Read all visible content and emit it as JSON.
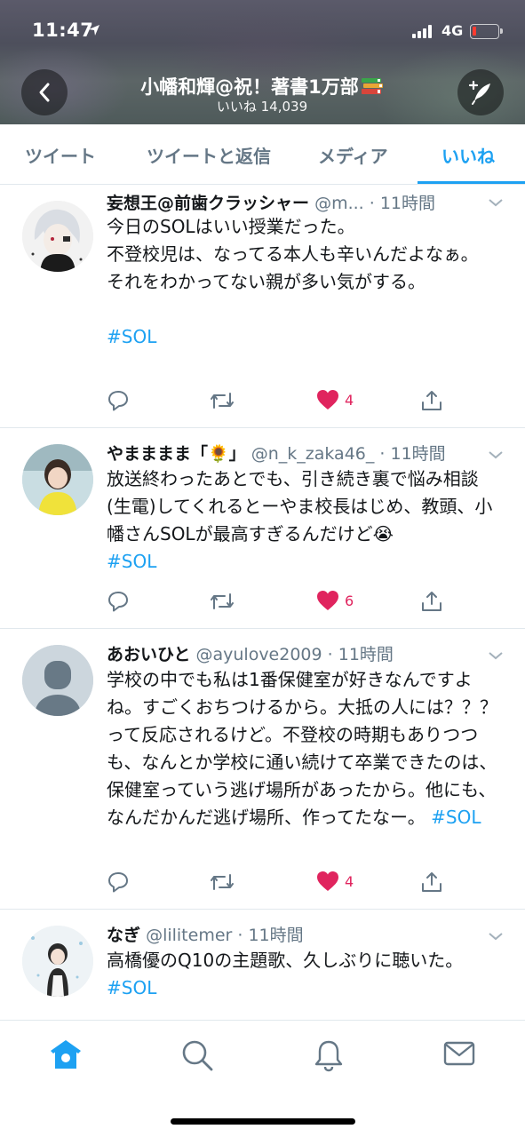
{
  "status_bar": {
    "time": "11:47",
    "network": "4G"
  },
  "header": {
    "title": "小幡和輝@祝！著書1万部",
    "subtitle": "いいね 14,039"
  },
  "tabs": [
    {
      "label": "ツイート",
      "active": false
    },
    {
      "label": "ツイートと返信",
      "active": false
    },
    {
      "label": "メディア",
      "active": false
    },
    {
      "label": "いいね",
      "active": true
    }
  ],
  "tweets": [
    {
      "name": "妄想王@前歯クラッシャー",
      "handle": "@m...",
      "time": "· 11時間",
      "body": "今日のSOLはいい授業だった。\n不登校児は、なってる本人も辛いんだよなぁ。\nそれをわかってない親が多い気がする。\n",
      "hashtag": "#SOL",
      "likes": "4"
    },
    {
      "name": "やまままま「🌻」",
      "handle": "@n_k_zaka46_",
      "time": "· 11時間",
      "body": "放送終わったあとでも、引き続き裏で悩み相談(生電)してくれるとーやま校長はじめ、教頭、小幡さんSOLが最高すぎるんだけど😭",
      "hashtag": "#SOL",
      "likes": "6"
    },
    {
      "name": "あおいひと",
      "handle": "@ayulove2009",
      "time": "· 11時間",
      "body": "学校の中でも私は1番保健室が好きなんですよね。すごくおちつけるから。大抵の人には？？？って反応されるけど。不登校の時期もありつつも、なんとか学校に通い続けて卒業できたのは、保健室っていう逃げ場所があったから。他にも、なんだかんだ逃げ場所、作ってたなー。 ",
      "hashtag": "#SOL",
      "likes": "4"
    },
    {
      "name": "なぎ",
      "handle": "@lilitemer",
      "time": "· 11時間",
      "body": "高橋優のQ10の主題歌、久しぶりに聴いた。",
      "hashtag": "#SOL"
    }
  ],
  "colors": {
    "accent": "#1da1f2",
    "like": "#e0245e",
    "muted": "#657786"
  }
}
